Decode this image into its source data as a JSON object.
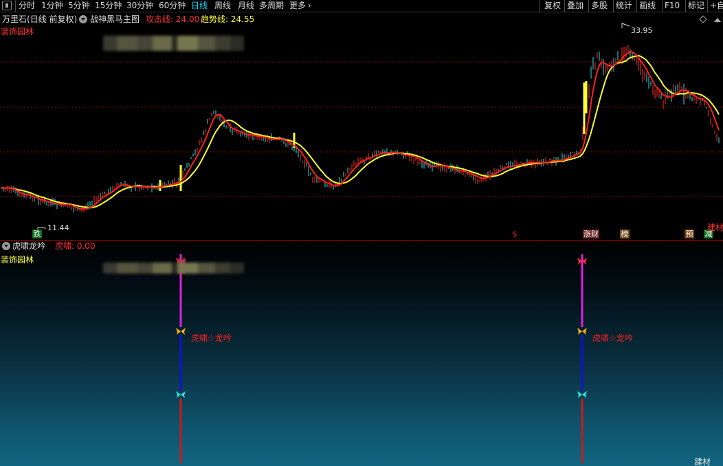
{
  "toolbar": {
    "periods": [
      "分时",
      "1分钟",
      "5分钟",
      "15分钟",
      "30分钟",
      "60分钟",
      "日线",
      "周线",
      "月线",
      "多周期",
      "更多"
    ],
    "active_period": "日线",
    "right_buttons": [
      "复权",
      "叠加",
      "多股",
      "统计",
      "画线",
      "F10",
      "标记",
      "+自"
    ]
  },
  "main": {
    "stock_label": "万里石(日线 前复权)",
    "indicator_name": "战神黑马主图",
    "attack_label": "攻击线: 24.00",
    "trend_label": "趋势线: 24.55",
    "industry": "装饰园林",
    "high_label": "33.95",
    "low_label": "11.44",
    "tags": [
      {
        "text": "跌",
        "bg": "#0a6a1a",
        "color": "#ffffff"
      },
      {
        "text": "$",
        "bg": "transparent",
        "color": "#ff2020"
      },
      {
        "text": "涨财",
        "bg": "#6a2020",
        "color": "#ffffff"
      },
      {
        "text": "榜",
        "bg": "#7a5020",
        "color": "#ffffff"
      },
      {
        "text": "预",
        "bg": "#7a4010",
        "color": "#ffffff"
      },
      {
        "text": "减",
        "bg": "#0a6a1a",
        "color": "#ffffff"
      },
      {
        "text": "建材",
        "bg": "transparent",
        "color": "#ff3030"
      }
    ]
  },
  "sub": {
    "indicator_name": "虎啸龙吟",
    "value_label": "虎啸: 0.00",
    "industry": "装饰园林",
    "signal_text": "虎啸☆龙吟",
    "footer": "建材"
  },
  "colors": {
    "attack_line": "#ff2020",
    "trend_line": "#ffff30",
    "up_candle": "#ff3030",
    "down_candle": "#30e0e0",
    "signal_magenta": "#e020e0",
    "signal_blue": "#1010e0",
    "signal_red": "#d01818"
  }
}
